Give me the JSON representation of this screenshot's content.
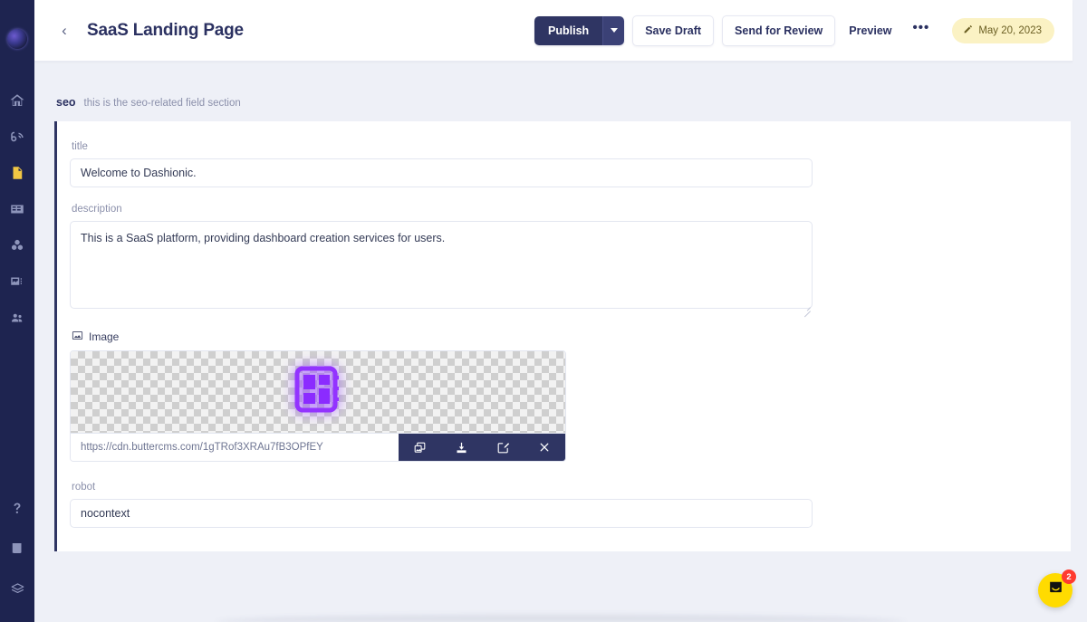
{
  "sidebar": {
    "logo": "dashionic-logo",
    "items": [
      {
        "name": "home",
        "icon": "home-icon",
        "active": false
      },
      {
        "name": "blog",
        "icon": "blog-icon",
        "active": false
      },
      {
        "name": "pages",
        "icon": "page-icon",
        "active": true
      },
      {
        "name": "collections",
        "icon": "collections-icon",
        "active": false
      },
      {
        "name": "components",
        "icon": "components-icon",
        "active": false
      },
      {
        "name": "media",
        "icon": "media-icon",
        "active": false
      },
      {
        "name": "team",
        "icon": "team-icon",
        "active": false
      }
    ],
    "bottom_items": [
      {
        "name": "help",
        "icon": "question-mark-icon"
      },
      {
        "name": "docs",
        "icon": "book-icon"
      },
      {
        "name": "layers",
        "icon": "layers-icon"
      }
    ]
  },
  "header": {
    "back_label": "‹",
    "title": "SaaS Landing Page",
    "publish_label": "Publish",
    "publish_caret": "chevron-down-icon",
    "save_draft_label": "Save Draft",
    "send_for_review_label": "Send for Review",
    "preview_label": "Preview",
    "more_label": "•••",
    "date_label": "May 20, 2023",
    "date_icon": "pencil-icon"
  },
  "section": {
    "name": "seo",
    "description": "this is the seo-related field section"
  },
  "form": {
    "title_field": {
      "label": "title",
      "value": "Welcome to Dashionic.",
      "placeholder": "title"
    },
    "description_field": {
      "label": "description",
      "value": "This is a SaaS platform, providing dashboard creation services for users.",
      "placeholder": "description"
    },
    "image_field": {
      "label": "Image",
      "icon": "image-icon",
      "url": "https://cdn.buttercms.com/1gTRof3XRAu7fB3OPfEY",
      "actions": [
        {
          "name": "copy-image-button",
          "icon": "copy-image-icon"
        },
        {
          "name": "download-button",
          "icon": "download-icon"
        },
        {
          "name": "edit-image-button",
          "icon": "edit-icon"
        },
        {
          "name": "remove-image-button",
          "icon": "close-icon"
        }
      ]
    },
    "robot_field": {
      "label": "robot",
      "value": "nocontext",
      "placeholder": "robot"
    }
  },
  "support": {
    "icon": "chat-icon",
    "badge_count": "2"
  },
  "colors": {
    "sidebar_bg": "#1e2450",
    "page_bg": "#eef0f7",
    "accent_dark": "#2f3563",
    "accent_yellow": "#f2c744",
    "date_pill_bg": "#fbf2c4",
    "launcher_bg": "#ffdb00",
    "badge_red": "#ff3b30",
    "thumb_purple": "#8b2bff"
  }
}
